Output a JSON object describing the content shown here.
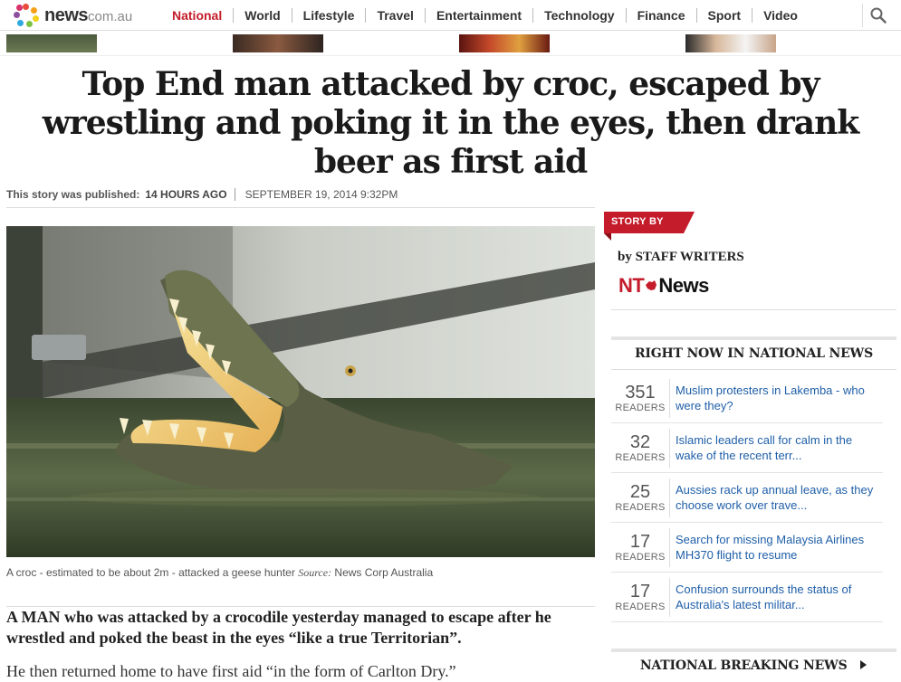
{
  "site": {
    "logo_main": "news",
    "logo_suffix": "com.au"
  },
  "nav": {
    "items": [
      {
        "label": "National",
        "active": true
      },
      {
        "label": "World"
      },
      {
        "label": "Lifestyle"
      },
      {
        "label": "Travel"
      },
      {
        "label": "Entertainment"
      },
      {
        "label": "Technology"
      },
      {
        "label": "Finance"
      },
      {
        "label": "Sport"
      },
      {
        "label": "Video"
      }
    ],
    "search_icon": "search-icon"
  },
  "article": {
    "headline": "Top End man attacked by croc, escaped by wrestling and poking it in the eyes, then drank beer as first aid",
    "published_label": "This story was published:",
    "published_ago": "14 HOURS AGO",
    "published_date": "SEPTEMBER 19, 2014  9:32PM",
    "image_caption": "A croc - estimated to be about 2m - attacked a geese hunter",
    "caption_source_label": "Source:",
    "caption_source": "News Corp Australia",
    "lead": "A MAN who was attacked by a crocodile yesterday managed to escape after he wrestled and poked the beast in the eyes “like a true Territorian”.",
    "para2": "He then returned home to have first aid “in the form of Carlton Dry.”"
  },
  "sidebar": {
    "story_by_label": "STORY BY",
    "byline": "by STAFF WRITERS",
    "publisher_logo_a": "NT",
    "publisher_logo_b": "News",
    "right_now_title": "RIGHT NOW IN NATIONAL NEWS",
    "readers_label": "READERS",
    "right_now_items": [
      {
        "count": "351",
        "title": "Muslim protesters in Lakemba - who were they?"
      },
      {
        "count": "32",
        "title": "Islamic leaders call for calm in the wake of the recent terr..."
      },
      {
        "count": "25",
        "title": "Aussies rack up annual leave, as they choose work over trave..."
      },
      {
        "count": "17",
        "title": "Search for missing Malaysia Airlines MH370 flight to resume"
      },
      {
        "count": "17",
        "title": "Confusion surrounds the status of Australia's latest militar..."
      }
    ],
    "breaking_title": "NATIONAL BREAKING NEWS"
  },
  "colors": {
    "brand_red": "#c41c2b",
    "link_blue": "#1f5fa8"
  }
}
